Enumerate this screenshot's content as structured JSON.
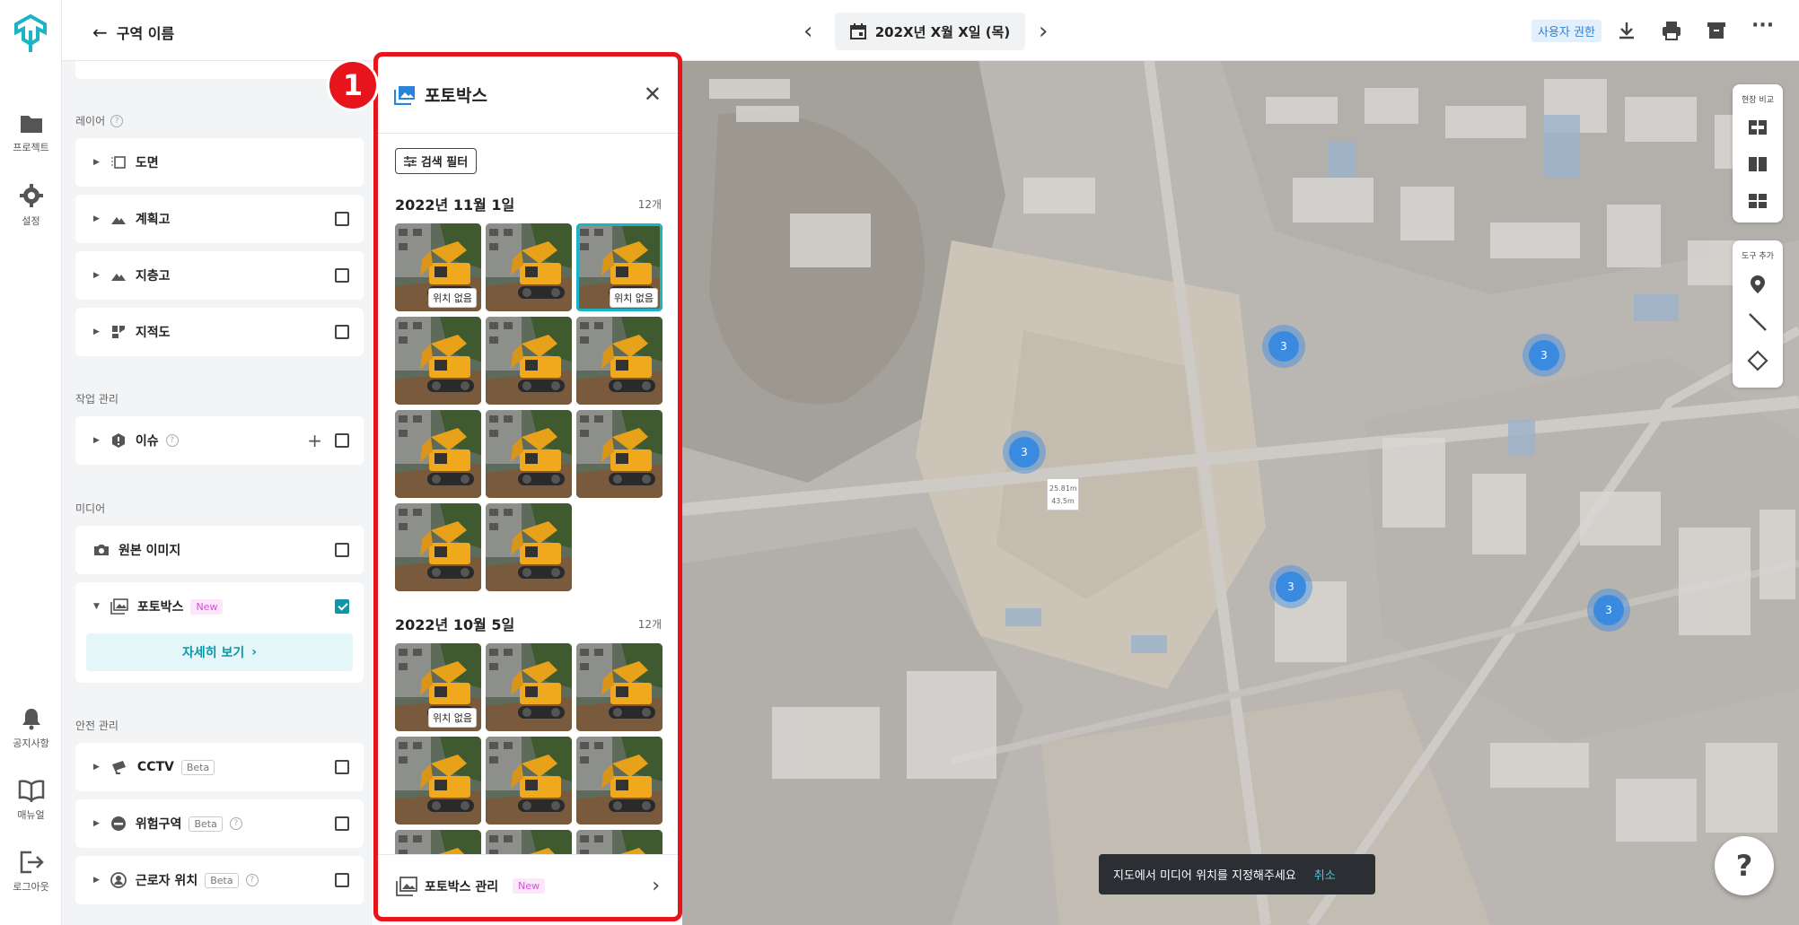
{
  "rail": {
    "items": [
      {
        "label": "프로젝트",
        "icon": "folder-icon"
      },
      {
        "label": "설정",
        "icon": "gear-icon"
      },
      {
        "label": "공지사항",
        "icon": "bell-icon"
      },
      {
        "label": "매뉴얼",
        "icon": "book-icon"
      },
      {
        "label": "로그아웃",
        "icon": "logout-icon"
      }
    ]
  },
  "panel": {
    "back_label": "구역 이름",
    "section_layers": "레이어",
    "layers": [
      "도면",
      "계획고",
      "지층고",
      "지적도"
    ],
    "section_work": "작업 관리",
    "work_issue": "이슈",
    "section_media": "미디어",
    "media_original": "원본 이미지",
    "media_photobox": "포토박스",
    "new_badge": "New",
    "detail_button": "자세히 보기",
    "section_safety": "안전 관리",
    "safety": [
      "CCTV",
      "위험구역",
      "근로자 위치"
    ],
    "beta_badge": "Beta"
  },
  "topbar": {
    "date": "202X년 X월 X일 (목)",
    "user_permission": "사용자 권한"
  },
  "photobox": {
    "title": "포토박스",
    "filter_label": "검색 필터",
    "groups": [
      {
        "date": "2022년 11월 1일",
        "count": "12개"
      },
      {
        "date": "2022년 10월 5일",
        "count": "12개"
      }
    ],
    "no_location_tag": "위치 없음",
    "footer_label": "포토박스 관리",
    "footer_badge": "New"
  },
  "map": {
    "clusters": [
      "3",
      "3",
      "3",
      "3",
      "3"
    ],
    "measure": [
      "25.81m",
      "43.5m"
    ],
    "compare_label": "현장 비교",
    "tools_label": "도구 추가"
  },
  "toast": {
    "message": "지도에서 미디어 위치를 지정해주세요",
    "cancel": "취소"
  },
  "help": "?",
  "callout_number": "1",
  "colors": {
    "accent": "#0c96a8",
    "highlight_border": "#e8141c",
    "cluster": "#3a8be0"
  }
}
